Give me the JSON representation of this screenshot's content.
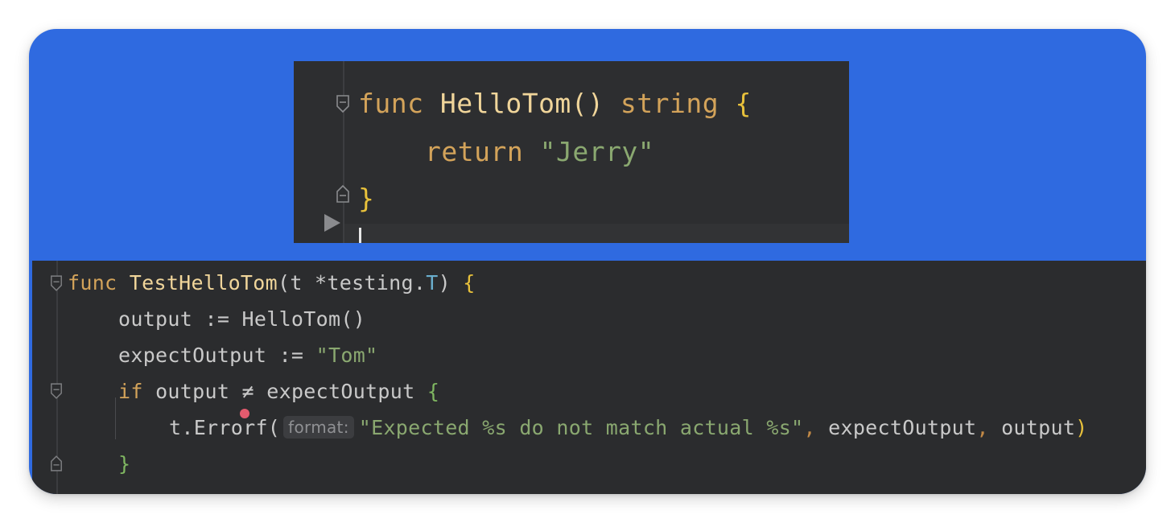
{
  "top_editor": {
    "line1": {
      "kw_func": "func",
      "name": "HelloTom()",
      "kw_type": "string",
      "brace": "{"
    },
    "line2": {
      "kw_return": "return",
      "value": "\"Jerry\""
    },
    "line3": {
      "brace": "}"
    }
  },
  "bottom_editor": {
    "line1": {
      "kw_func": "func",
      "name": "TestHelloTom",
      "params_open": "(t *testing.",
      "type_T": "T",
      "params_close": ")",
      "brace": "{"
    },
    "line2": {
      "var": "output",
      "op": ":=",
      "call": "HelloTom()"
    },
    "line3": {
      "var": "expectOutput",
      "op": ":=",
      "value": "\"Tom\""
    },
    "line4": {
      "kw_if": "if",
      "left": "output",
      "op": "≠",
      "right": "expectOutput",
      "brace": "{"
    },
    "line5": {
      "call": "t.Errorf(",
      "hint": "format:",
      "fmt_str": "\"Expected %s do not match actual %s\"",
      "comma1": ",",
      "arg1": "expectOutput",
      "comma2": ",",
      "arg2": "output",
      "close": ")"
    },
    "line6": {
      "brace": "}"
    }
  },
  "icons": {
    "fold": "fold-marker-icon",
    "run": "run-arrow-icon",
    "breakpoint": "breakpoint-dot-icon"
  },
  "colors": {
    "background": "#2f6ae0",
    "editor": "#2b2c2e",
    "keyword": "#d3a35a",
    "function": "#f0d59a",
    "string": "#8aa870"
  }
}
